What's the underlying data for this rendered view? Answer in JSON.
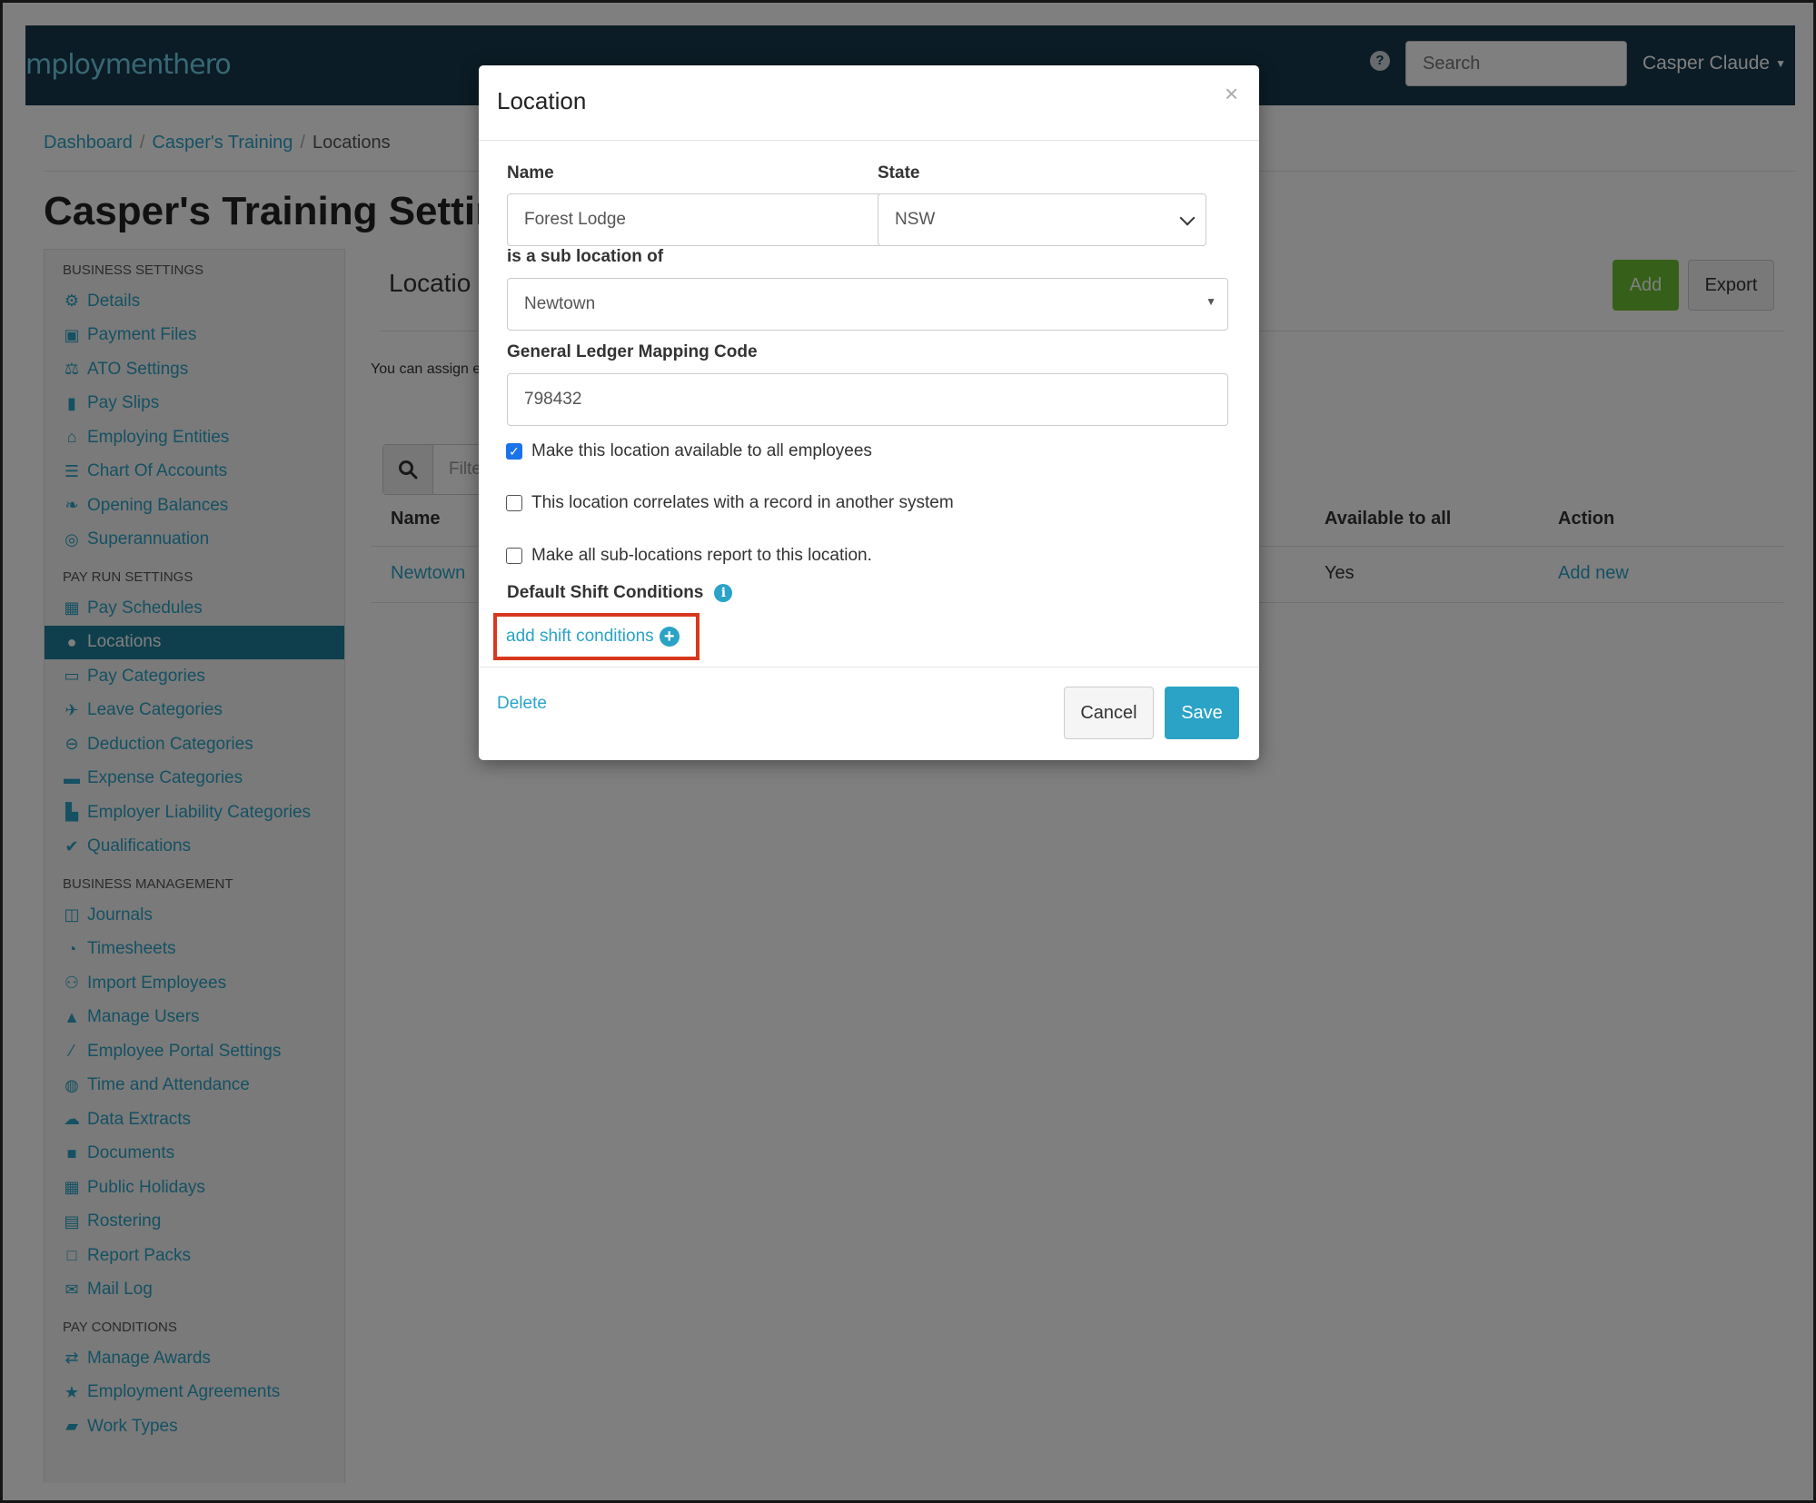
{
  "topbar": {
    "logo": "mploymenthero",
    "search_placeholder": "Search",
    "user_name": "Casper Claude"
  },
  "breadcrumb": {
    "items": [
      "Dashboard",
      "Casper's Training",
      "Locations"
    ]
  },
  "page_title": "Casper's Training Settings",
  "sidebar": {
    "sections": [
      {
        "heading": "BUSINESS SETTINGS",
        "items": [
          {
            "label": "Details",
            "icon": "gear-icon"
          },
          {
            "label": "Payment Files",
            "icon": "floppy-icon"
          },
          {
            "label": "ATO Settings",
            "icon": "scales-icon"
          },
          {
            "label": "Pay Slips",
            "icon": "file-icon"
          },
          {
            "label": "Employing Entities",
            "icon": "bank-icon"
          },
          {
            "label": "Chart Of Accounts",
            "icon": "list-icon"
          },
          {
            "label": "Opening Balances",
            "icon": "leaf-icon"
          },
          {
            "label": "Superannuation",
            "icon": "lifebuoy-icon"
          }
        ]
      },
      {
        "heading": "PAY RUN SETTINGS",
        "items": [
          {
            "label": "Pay Schedules",
            "icon": "calendar-icon"
          },
          {
            "label": "Locations",
            "icon": "globe-icon",
            "active": true
          },
          {
            "label": "Pay Categories",
            "icon": "money-icon"
          },
          {
            "label": "Leave Categories",
            "icon": "plane-icon"
          },
          {
            "label": "Deduction Categories",
            "icon": "minus-circle-icon"
          },
          {
            "label": "Expense Categories",
            "icon": "archive-icon"
          },
          {
            "label": "Employer Liability Categories",
            "icon": "industry-icon"
          },
          {
            "label": "Qualifications",
            "icon": "check-icon"
          }
        ]
      },
      {
        "heading": "BUSINESS MANAGEMENT",
        "items": [
          {
            "label": "Journals",
            "icon": "columns-icon"
          },
          {
            "label": "Timesheets",
            "icon": "clock-icon"
          },
          {
            "label": "Import Employees",
            "icon": "people-icon"
          },
          {
            "label": "Manage Users",
            "icon": "lock-icon"
          },
          {
            "label": "Employee Portal Settings",
            "icon": "wand-icon"
          },
          {
            "label": "Time and Attendance",
            "icon": "headset-icon"
          },
          {
            "label": "Data Extracts",
            "icon": "cloud-download-icon"
          },
          {
            "label": "Documents",
            "icon": "folder-icon"
          },
          {
            "label": "Public Holidays",
            "icon": "calendar-icon"
          },
          {
            "label": "Rostering",
            "icon": "calendar-grid-icon"
          },
          {
            "label": "Report Packs",
            "icon": "folder-open-icon"
          },
          {
            "label": "Mail Log",
            "icon": "envelope-icon"
          }
        ]
      },
      {
        "heading": "PAY CONDITIONS",
        "items": [
          {
            "label": "Manage Awards",
            "icon": "exchange-icon"
          },
          {
            "label": "Employment Agreements",
            "icon": "star-icon"
          },
          {
            "label": "Work Types",
            "icon": "book-icon"
          }
        ]
      }
    ]
  },
  "main": {
    "heading": "Locatio",
    "add_label": "Add",
    "export_label": "Export",
    "intro": "You can assign e",
    "filter_placeholder": "Filte",
    "table": {
      "headers": {
        "name": "Name",
        "available": "Available to all",
        "action": "Action"
      },
      "rows": [
        {
          "name": "Newtown",
          "available": "Yes",
          "action": "Add new"
        }
      ]
    }
  },
  "modal": {
    "title": "Location",
    "close": "×",
    "name_label": "Name",
    "name_value": "Forest Lodge",
    "state_label": "State",
    "state_value": "NSW",
    "sub_location_label": "is a sub location of",
    "sub_location_value": "Newtown",
    "gl_label": "General Ledger Mapping Code",
    "gl_value": "798432",
    "checkboxes": [
      {
        "label": "Make this location available to all employees",
        "checked": true
      },
      {
        "label": "This location correlates with a record in another system",
        "checked": false
      },
      {
        "label": "Make all sub-locations report to this location.",
        "checked": false
      }
    ],
    "shift_conditions_label": "Default Shift Conditions",
    "add_shift_label": "add shift conditions",
    "delete_label": "Delete",
    "cancel_label": "Cancel",
    "save_label": "Save"
  },
  "colors": {
    "topbar": "#17384d",
    "link": "#2aa3c7",
    "add_button": "#6cbf33",
    "save_button": "#2aa3c7",
    "highlight": "#d7381e"
  }
}
